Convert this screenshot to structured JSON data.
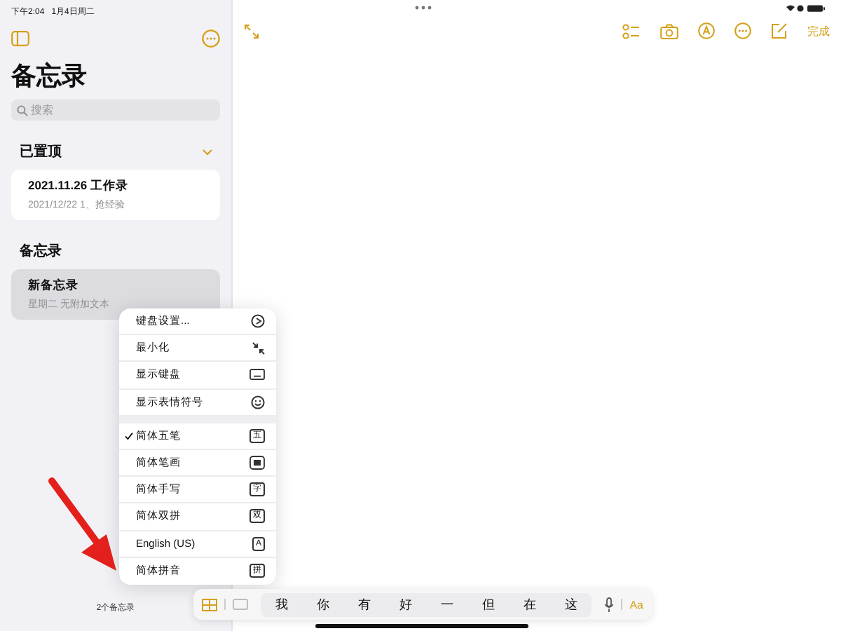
{
  "status_bar": {
    "time": "下午2:04",
    "date": "1月4日周二"
  },
  "sidebar": {
    "title": "备忘录",
    "search": {
      "placeholder": "搜索"
    },
    "sections": [
      {
        "title": "已置顶",
        "expanded": true,
        "notes": [
          {
            "title": "2021.11.26 工作录",
            "subtitle": "2021/12/22  1、抢经验",
            "selected": false
          }
        ]
      },
      {
        "title": "备忘录",
        "notes": [
          {
            "title": "新备忘录",
            "subtitle": "星期二  无附加文本",
            "selected": true
          }
        ]
      }
    ],
    "count": "2个备忘录"
  },
  "toolbar": {
    "done": "完成"
  },
  "menu": {
    "groups": [
      [
        {
          "label": "键盘设置...",
          "kind": "gear"
        },
        {
          "label": "最小化",
          "kind": "minimize"
        },
        {
          "label": "显示键盘",
          "kind": "keyboard"
        },
        {
          "label": "显示表情符号",
          "kind": "emoji"
        }
      ],
      [
        {
          "label": "简体五笔",
          "checked": true,
          "badge": "五"
        },
        {
          "label": "简体笔画",
          "checked": false,
          "kind": "grid"
        },
        {
          "label": "简体手写",
          "checked": false,
          "badge": "字"
        },
        {
          "label": "简体双拼",
          "checked": false,
          "badge": "双"
        },
        {
          "label": "English (US)",
          "checked": false,
          "badge": "A"
        },
        {
          "label": "简体拼音",
          "checked": false,
          "badge": "拼"
        }
      ]
    ]
  },
  "candidate_bar": {
    "candidates": [
      "我",
      "你",
      "有",
      "好",
      "一",
      "但",
      "在",
      "这"
    ],
    "format": "Aa"
  }
}
